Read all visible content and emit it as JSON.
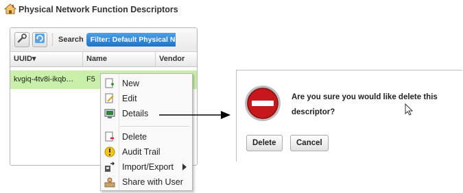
{
  "page": {
    "title": "Physical Network Function Descriptors"
  },
  "toolbar": {
    "search_label": "Search",
    "filter_label": "Filter: Default Physical Ne"
  },
  "table": {
    "columns": [
      "UUID▾",
      "Name",
      "Vendor"
    ],
    "rows": [
      {
        "uuid": "kvgiq-4tv8i-ikqb…",
        "name": "F5"
      }
    ]
  },
  "context_menu": {
    "items": [
      {
        "label": "New",
        "icon": "new-document-icon"
      },
      {
        "label": "Edit",
        "icon": "edit-icon"
      },
      {
        "label": "Details",
        "icon": "details-icon"
      },
      {
        "label": "Delete",
        "icon": "delete-icon"
      },
      {
        "label": "Audit Trail",
        "icon": "audit-trail-icon"
      },
      {
        "label": "Import/Export",
        "icon": "import-export-icon"
      },
      {
        "label": "Share with User",
        "icon": "share-with-user-icon"
      }
    ]
  },
  "dialog": {
    "message": "Are you sure you would like delete this descriptor?",
    "delete_label": "Delete",
    "cancel_label": "Cancel"
  },
  "colors": {
    "selected_row": "#c9f0a8",
    "filter_pill": "#1f73c9",
    "stop_icon": "#c8161d"
  }
}
